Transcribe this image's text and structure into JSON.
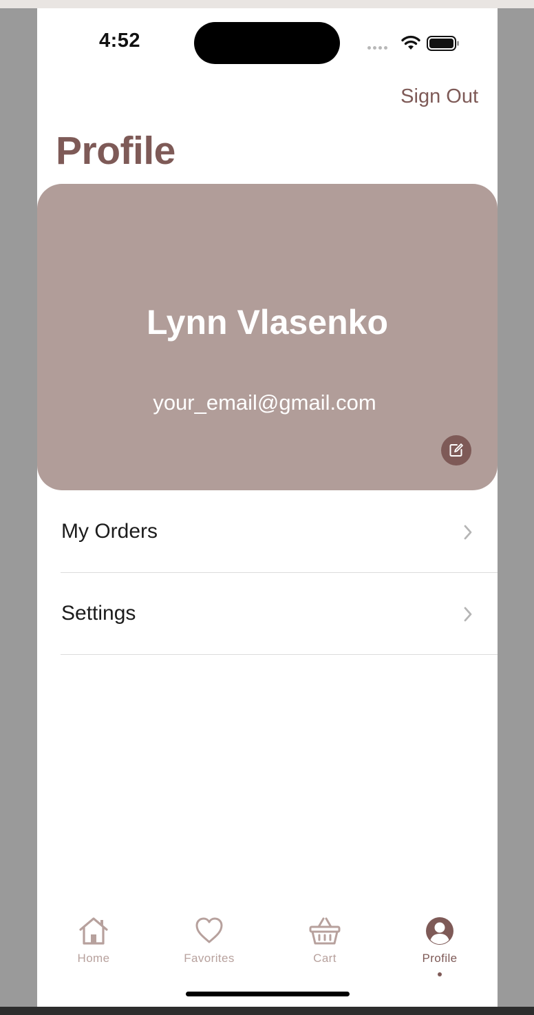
{
  "status_bar": {
    "time": "4:52"
  },
  "header": {
    "sign_out_label": "Sign Out",
    "title": "Profile"
  },
  "profile": {
    "name": "Lynn Vlasenko",
    "email": "your_email@gmail.com"
  },
  "menu": [
    {
      "label": "My Orders"
    },
    {
      "label": "Settings"
    }
  ],
  "tabs": [
    {
      "label": "Home",
      "icon": "home-icon"
    },
    {
      "label": "Favorites",
      "icon": "heart-icon"
    },
    {
      "label": "Cart",
      "icon": "basket-icon"
    },
    {
      "label": "Profile",
      "icon": "user-circle-icon",
      "active": true
    }
  ],
  "colors": {
    "accent": "#7e5a57",
    "card": "#b19d99",
    "tab_inactive": "#b7a19d"
  }
}
